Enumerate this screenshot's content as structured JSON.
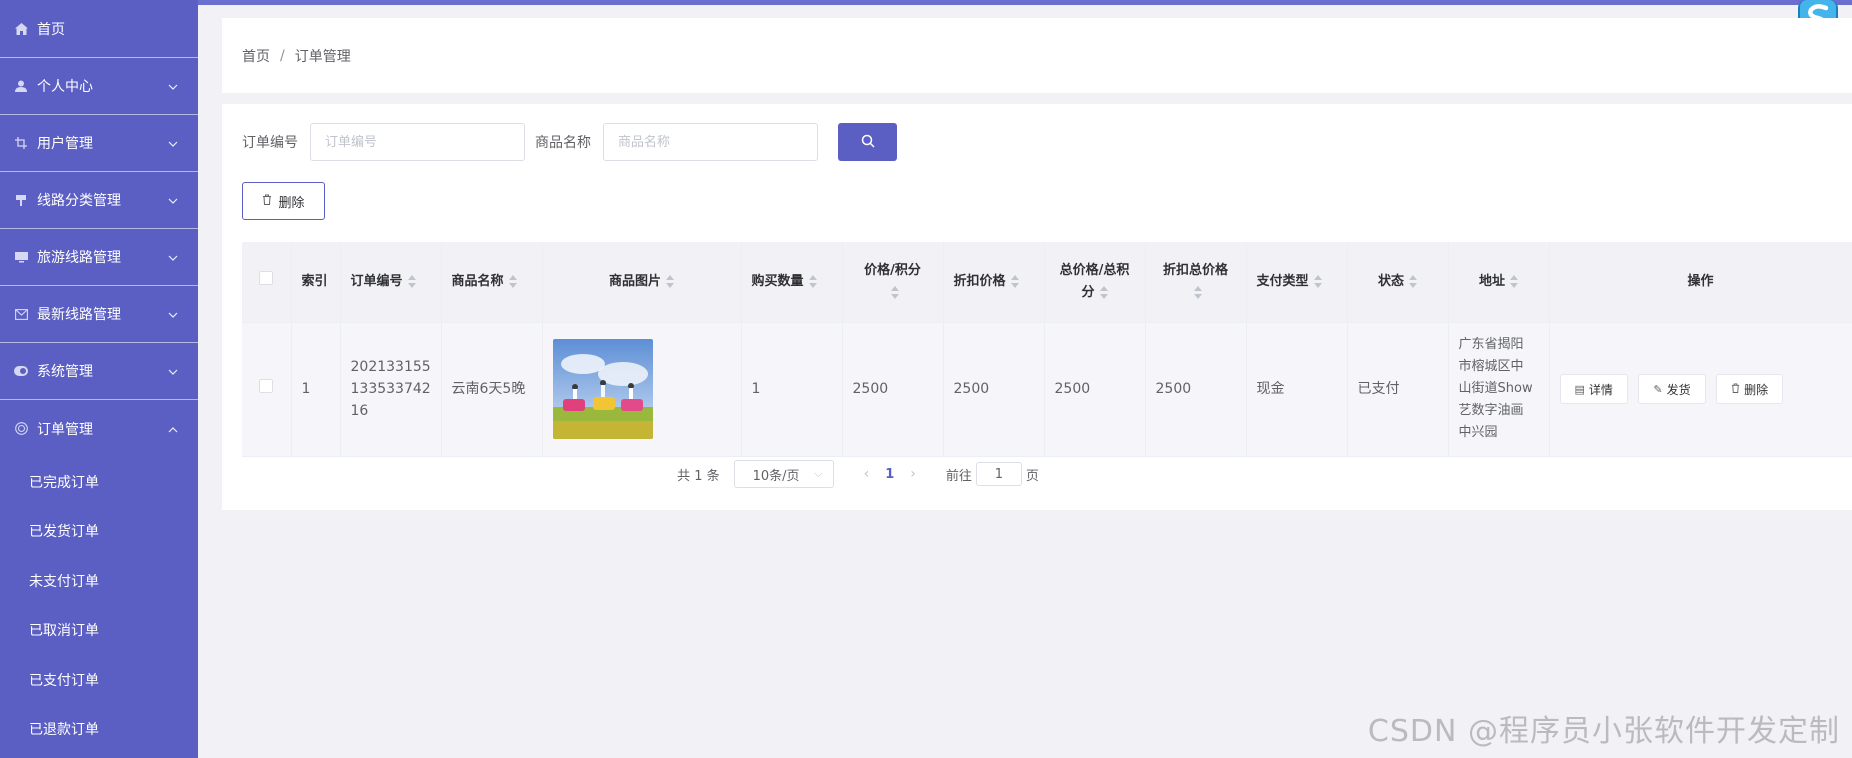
{
  "sidebar": {
    "items": [
      {
        "label": "首页",
        "icon": "home-icon",
        "expandable": false
      },
      {
        "label": "个人中心",
        "icon": "user-icon",
        "expandable": true
      },
      {
        "label": "用户管理",
        "icon": "crop-icon",
        "expandable": true
      },
      {
        "label": "线路分类管理",
        "icon": "pin-icon",
        "expandable": true
      },
      {
        "label": "旅游线路管理",
        "icon": "monitor-icon",
        "expandable": true
      },
      {
        "label": "最新线路管理",
        "icon": "mail-icon",
        "expandable": true
      },
      {
        "label": "系统管理",
        "icon": "switch-icon",
        "expandable": true
      },
      {
        "label": "订单管理",
        "icon": "circle-icon",
        "expandable": true,
        "expanded": true
      }
    ],
    "submenu": [
      "已完成订单",
      "已发货订单",
      "未支付订单",
      "已取消订单",
      "已支付订单",
      "已退款订单"
    ]
  },
  "breadcrumb": {
    "home": "首页",
    "separator": "/",
    "current": "订单管理"
  },
  "search": {
    "order_no_label": "订单编号",
    "order_no_placeholder": "订单编号",
    "goods_name_label": "商品名称",
    "goods_name_placeholder": "商品名称"
  },
  "toolbar": {
    "delete_label": "删除"
  },
  "table": {
    "headers": {
      "index": "索引",
      "order_no": "订单编号",
      "goods_name": "商品名称",
      "goods_image": "商品图片",
      "quantity": "购买数量",
      "price_line1": "价格/积分",
      "discount_price": "折扣价格",
      "total_line1": "总价格/总积",
      "total_line2": "分",
      "discount_total": "折扣总价格",
      "pay_type": "支付类型",
      "status": "状态",
      "address": "地址",
      "actions": "操作"
    },
    "rows": [
      {
        "index": "1",
        "order_no_1": "202133155",
        "order_no_2": "133533742",
        "order_no_3": "16",
        "goods_name": "云南6天5晚",
        "quantity": "1",
        "price": "2500",
        "discount_price": "2500",
        "total": "2500",
        "discount_total": "2500",
        "pay_type": "现金",
        "status": "已支付",
        "address_1": "广东省揭阳",
        "address_2": "市榕城区中",
        "address_3": "山街道Show",
        "address_4": "艺数字油画",
        "address_5": "中兴园",
        "actions": {
          "detail": "详情",
          "ship": "发货",
          "delete": "删除"
        }
      }
    ]
  },
  "pagination": {
    "total": "共 1 条",
    "page_size": "10条/页",
    "current_page": "1",
    "goto_prefix": "前往",
    "goto_value": "1",
    "goto_suffix": "页"
  },
  "watermark": "CSDN @程序员小张软件开发定制",
  "colors": {
    "accent": "#5b5fc3",
    "background": "#f2f2f6"
  }
}
